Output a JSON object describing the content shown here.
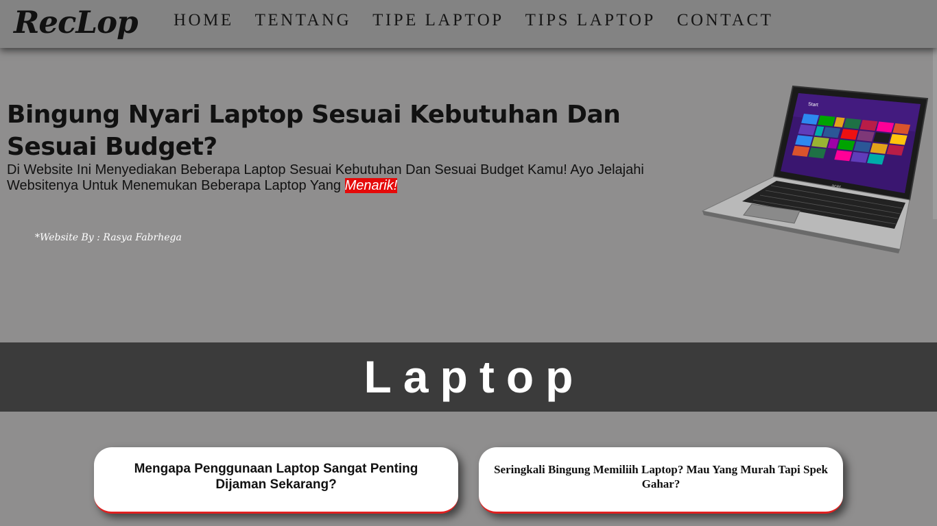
{
  "header": {
    "logo": "RecLop",
    "nav": [
      "HOME",
      "TENTANG",
      "TIPE LAPTOP",
      "TIPS LAPTOP",
      "CONTACT"
    ]
  },
  "hero": {
    "title": "Bingung Nyari Laptop Sesuai Kebutuhan Dan Sesuai Budget?",
    "description": "Di Website Ini Menyediakan Beberapa Laptop Sesuai Kebutuhan Dan Sesuai Budget Kamu! Ayo Jelajahi Websitenya Untuk Menemukan Beberapa Laptop Yang ",
    "highlight": "Menarik!",
    "credit": "*Website By : Rasya Fabrhega",
    "laptop_screen_label": "Start",
    "laptop_brand": "acer"
  },
  "section": {
    "title": "Laptop"
  },
  "cards": [
    {
      "text": "Mengapa Penggunaan Laptop Sangat Penting Dijaman Sekarang?"
    },
    {
      "text": "Seringkali Bingung Memiliih Laptop? Mau Yang Murah Tapi Spek Gahar?"
    }
  ],
  "colors": {
    "page_bg": "#8f8e8e",
    "navbar_bg": "#838383",
    "band_bg": "#3b3b3b",
    "highlight": "#e50a0a"
  }
}
